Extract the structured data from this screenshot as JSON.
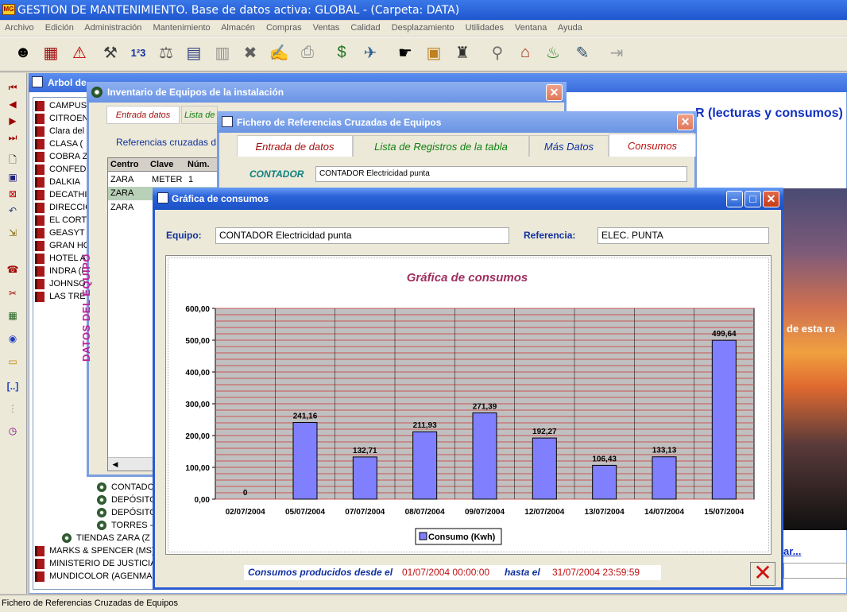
{
  "app": {
    "title": "GESTION DE MANTENIMIENTO. Base de datos activa: GLOBAL - (Carpeta: DATA)"
  },
  "menu": [
    "Archivo",
    "Edición",
    "Administración",
    "Mantenimiento",
    "Almacén",
    "Compras",
    "Ventas",
    "Calidad",
    "Desplazamiento",
    "Utilidades",
    "Ventana",
    "Ayuda"
  ],
  "tree": {
    "title": "Arbol de",
    "items": [
      "CAMPUS",
      "CITROEN",
      "Clara del",
      "CLASA (",
      "COBRA Z",
      "CONFEDI",
      "DALKIA",
      "DECATHI",
      "DIRECCIÓ",
      "EL CORT",
      "GEASYT",
      "GRAN HO",
      "HOTEL A",
      "INDRA (I",
      "JOHNSO",
      "LAS TRE"
    ],
    "sub": [
      "CONTADO",
      "DEPÓSITO",
      "DEPÓSITO",
      "TORRES -"
    ],
    "bottom": [
      "TIENDAS ZARA (Z",
      "MARKS & SPENCER (MS)",
      "MINISTERIO DE JUSTICIA (",
      "MUNDICOLOR (AGENMAD"
    ]
  },
  "inventory": {
    "title": "Inventario de Equipos de la instalación",
    "tabs": [
      "Entrada datos",
      "Lista de"
    ],
    "label": "Referencias cruzadas d",
    "columns": [
      "Centro",
      "Clave",
      "Núm."
    ],
    "rows": [
      [
        "ZARA",
        "METER",
        "1"
      ],
      [
        "ZARA",
        "",
        ""
      ],
      [
        "ZARA",
        "",
        ""
      ]
    ]
  },
  "side_label": "DATOS DEL EQUIPO",
  "xref": {
    "title": "Fichero de Referencias Cruzadas de Equipos",
    "tabs": [
      "Entrada de datos",
      "Lista de Registros de la tabla",
      "Más Datos",
      "Consumos"
    ],
    "contador_label": "CONTADOR",
    "contador_value": "CONTADOR Electricidad punta"
  },
  "bg": {
    "heading": "CONTADOR (lecturas y consumos)",
    "heading_visible": "R (lecturas y consumos)",
    "side_text": "de esta ra",
    "link": "ar..."
  },
  "graph_window": {
    "title": "Gráfica de consumos",
    "equipo_label": "Equipo:",
    "equipo_value": "CONTADOR Electricidad punta",
    "referencia_label": "Referencia:",
    "referencia_value": "ELEC. PUNTA",
    "footer_prefix": "Consumos producidos desde el",
    "footer_from": "01/07/2004 00:00:00",
    "footer_mid": "hasta el",
    "footer_to": "31/07/2004 23:59:59"
  },
  "chart_data": {
    "type": "bar",
    "title": "Gráfica de consumos",
    "categories": [
      "02/07/2004",
      "05/07/2004",
      "07/07/2004",
      "08/07/2004",
      "09/07/2004",
      "12/07/2004",
      "13/07/2004",
      "14/07/2004",
      "15/07/2004"
    ],
    "series": [
      {
        "name": "Consumo (Kwh)",
        "values": [
          0,
          241.16,
          132.71,
          211.93,
          271.39,
          192.27,
          106.43,
          133.13,
          499.64
        ],
        "labels": [
          "0",
          "241,16",
          "132,71",
          "211,93",
          "271,39",
          "192,27",
          "106,43",
          "133,13",
          "499,64"
        ]
      }
    ],
    "yticks": [
      "0,00",
      "100,00",
      "200,00",
      "300,00",
      "400,00",
      "500,00",
      "600,00"
    ],
    "ylim": [
      0,
      600
    ],
    "legend": "bottom",
    "colors": {
      "bar": "#8080ff",
      "plot_bg": "#c0c0c0",
      "grid": "#cc5555"
    }
  },
  "status": "Fichero de Referencias Cruzadas de Equipos"
}
